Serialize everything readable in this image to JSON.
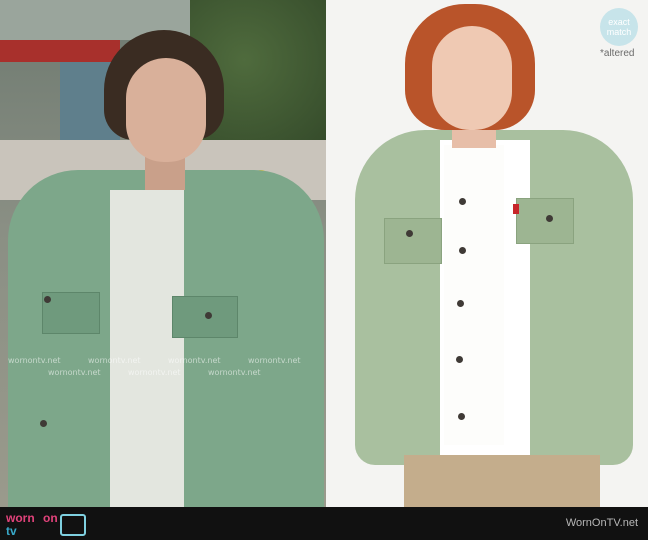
{
  "badge": {
    "line1": "exact",
    "line2": "match",
    "note": "*altered"
  },
  "watermark": "wornontv.net",
  "footer": {
    "logo_word1": "worn",
    "logo_word2": "on",
    "logo_word3": "tv",
    "site": "WornOnTV.net"
  },
  "colors": {
    "badge_bg": "#c7e4ea",
    "logo_pink": "#e2437b",
    "logo_blue": "#38a8c8",
    "footer_bg": "#111111"
  }
}
